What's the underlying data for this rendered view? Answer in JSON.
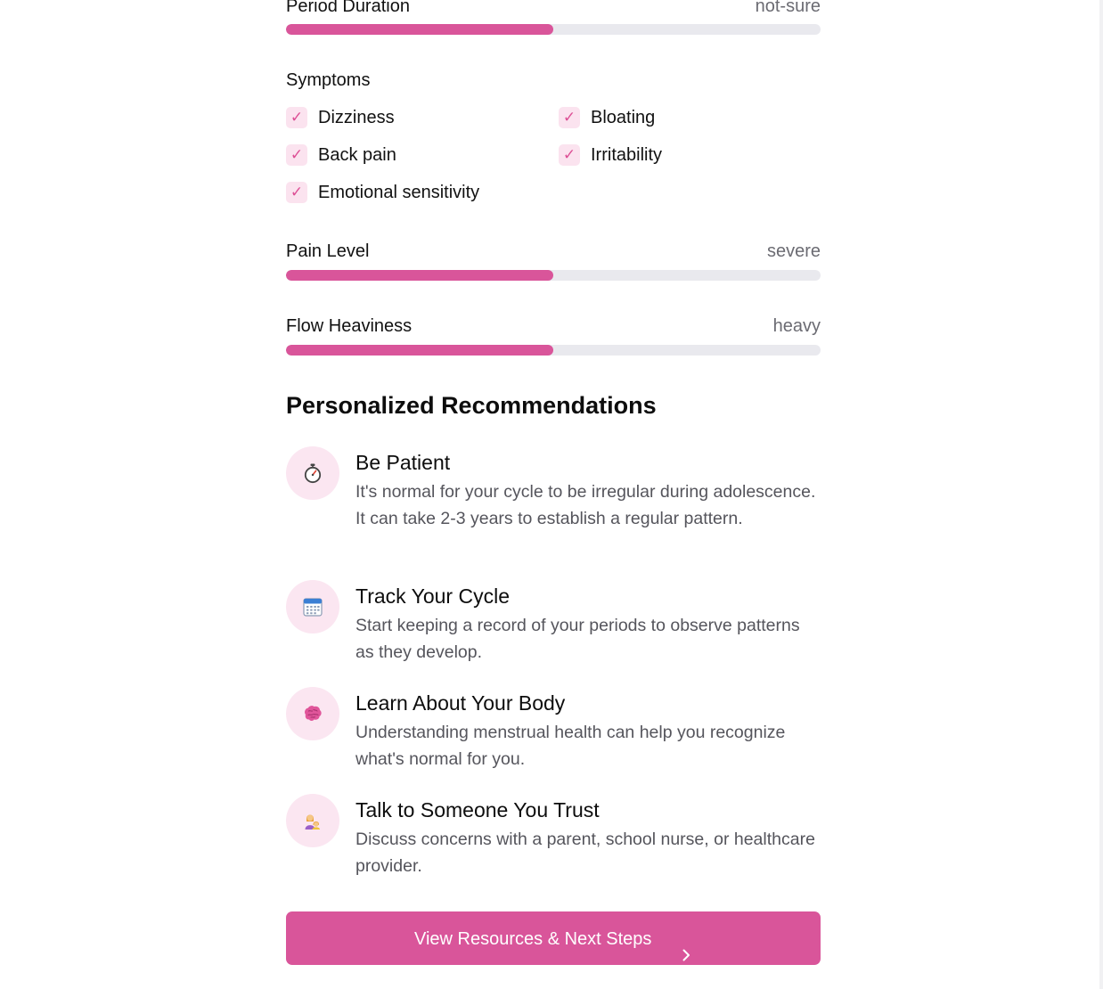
{
  "meters": {
    "period_duration": {
      "label": "Period Duration",
      "value": "not-sure",
      "fill_percent": 50
    },
    "pain_level": {
      "label": "Pain Level",
      "value": "severe",
      "fill_percent": 50
    },
    "flow_heaviness": {
      "label": "Flow Heaviness",
      "value": "heavy",
      "fill_percent": 50
    }
  },
  "symptoms": {
    "title": "Symptoms",
    "check_glyph": "✓",
    "items": [
      {
        "label": "Dizziness"
      },
      {
        "label": "Bloating"
      },
      {
        "label": "Back pain"
      },
      {
        "label": "Irritability"
      },
      {
        "label": "Emotional sensitivity"
      }
    ]
  },
  "recommendations": {
    "title": "Personalized Recommendations",
    "items": [
      {
        "icon": "stopwatch-icon",
        "title": "Be Patient",
        "description": "It's normal for your cycle to be irregular during adolescence. It can take 2-3 years to establish a regular pattern."
      },
      {
        "icon": "calendar-icon",
        "title": "Track Your Cycle",
        "description": "Start keeping a record of your periods to observe patterns as they develop."
      },
      {
        "icon": "brain-icon",
        "title": "Learn About Your Body",
        "description": "Understanding menstrual health can help you recognize what's normal for you."
      },
      {
        "icon": "parent-child-icon",
        "title": "Talk to Someone You Trust",
        "description": "Discuss concerns with a parent, school nurse, or healthcare provider."
      }
    ]
  },
  "cta": {
    "label": "View Resources & Next Steps",
    "icon": "chevron-right-icon"
  },
  "colors": {
    "accent": "#d9559a",
    "accent_soft": "#fbe6f1",
    "track": "#e9e9ee",
    "muted_text": "#6b6b72"
  }
}
